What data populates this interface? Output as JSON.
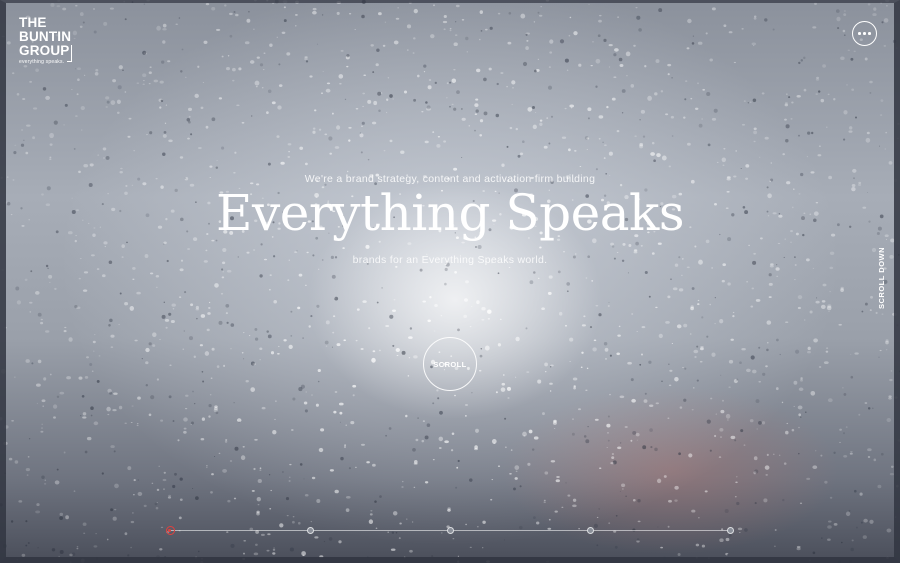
{
  "logo": {
    "line1": "THE",
    "line2": "BUNTIN",
    "line3": "GROUP",
    "tagline": "everything speaks."
  },
  "header": {
    "menu_icon": "more-horizontal-icon"
  },
  "hero": {
    "intro": "We're a brand strategy, content and activation firm building",
    "headline": "Everything Speaks",
    "subline": "brands for an Everything Speaks world."
  },
  "scroll_button": {
    "label": "SCROLL"
  },
  "side_scroll": {
    "label": "SCROLL DOWN"
  },
  "progress": {
    "active_index": 0,
    "total": 5
  },
  "colors": {
    "accent": "#e2403d",
    "text": "#ffffff"
  }
}
